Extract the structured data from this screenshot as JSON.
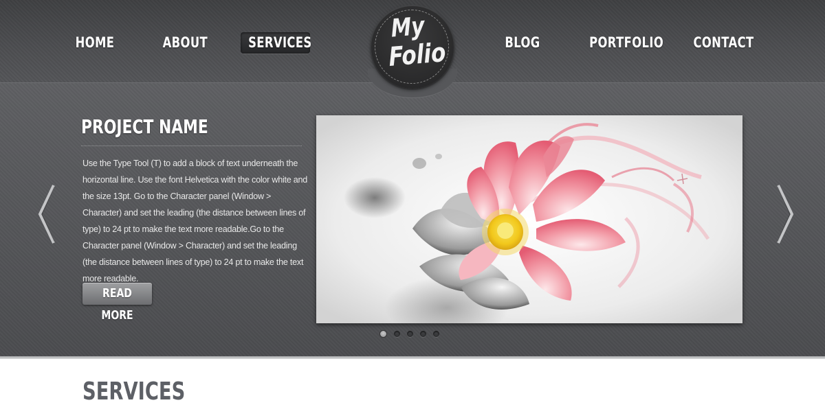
{
  "nav": {
    "items": [
      {
        "label": "HOME"
      },
      {
        "label": "ABOUT"
      },
      {
        "label": "SERVICES",
        "active": true
      },
      {
        "label": "BLOG"
      },
      {
        "label": "PORTFOLIO"
      },
      {
        "label": "CONTACT"
      }
    ]
  },
  "logo": {
    "line1": "My",
    "line2": "Folio"
  },
  "slider": {
    "project_title": "PROJECT NAME",
    "description": "Use the Type Tool (T) to add a block of text underneath the horizontal line. Use the font Helvetica with the color white and the size 13pt. Go to the Character panel (Window > Character) and set the leading (the distance between lines of type) to 24 pt to make the text more readable.Go to the Character panel (Window > Character) and set the leading (the distance between lines of type) to 24 pt to make the text more readable.",
    "read_more_label": "READ MORE",
    "prev_icon": "chevron-left-icon",
    "next_icon": "chevron-right-icon",
    "slide_image": "pink-lotus-flower-artwork",
    "dots": 5,
    "active_dot": 1
  },
  "services": {
    "title": "SERVICES"
  },
  "colors": {
    "header_bg": "#4a4b4e",
    "slider_bg": "#58595c",
    "text_white": "#ffffff",
    "services_title": "#5d6066",
    "flower_pink": "#ec7f90",
    "flower_center": "#f6d21f"
  }
}
